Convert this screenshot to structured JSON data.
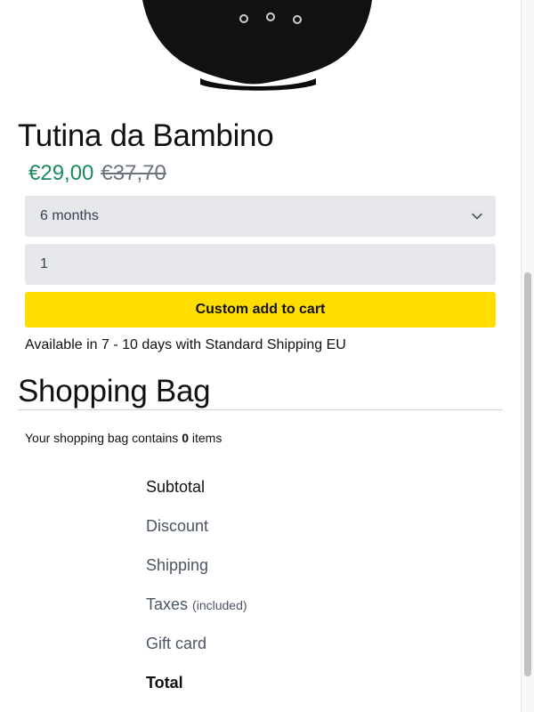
{
  "product": {
    "image_alt": "black baby bodysuit",
    "title": "Tutina da Bambino",
    "price_current": "€29,00",
    "price_old": "€37,70",
    "price_current_color": "#1a8a5c",
    "size_selected": "6 months",
    "quantity": "1",
    "add_button_label": "Custom add to cart",
    "add_button_color": "#ffdd00",
    "availability": "Available in 7 - 10 days with Standard Shipping EU"
  },
  "bag": {
    "title": "Shopping Bag",
    "count_prefix": "Your shopping bag contains ",
    "count": "0",
    "count_suffix": " items",
    "summary": {
      "subtotal": "Subtotal",
      "discount": "Discount",
      "shipping": "Shipping",
      "taxes": "Taxes",
      "taxes_note": "(included)",
      "gift_card": "Gift card",
      "total": "Total"
    }
  },
  "icons": {
    "select_chevron": "chevron-down-icon"
  }
}
